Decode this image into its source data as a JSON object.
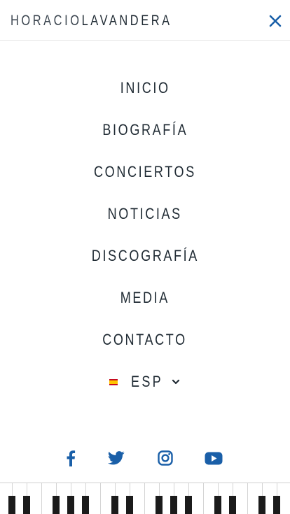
{
  "brand": {
    "first": "HORACIO",
    "last": "LAVANDERA"
  },
  "menu": {
    "items": [
      {
        "label": "INICIO"
      },
      {
        "label": "BIOGRAFÍA"
      },
      {
        "label": "CONCIERTOS"
      },
      {
        "label": "NOTICIAS"
      },
      {
        "label": "DISCOGRAFÍA"
      },
      {
        "label": "MEDIA"
      },
      {
        "label": "CONTACTO"
      }
    ]
  },
  "language": {
    "selected": "ESP",
    "flag_icon": "spain-flag-icon",
    "dropdown_icon": "chevron-down-icon"
  },
  "social": [
    {
      "icon": "facebook-icon"
    },
    {
      "icon": "twitter-icon"
    },
    {
      "icon": "instagram-icon"
    },
    {
      "icon": "youtube-icon"
    }
  ],
  "colors": {
    "text": "#1f2a33",
    "social_blue": "#1a5fa8",
    "close_blue": "#1a5fa8",
    "background": "#ffffff"
  }
}
